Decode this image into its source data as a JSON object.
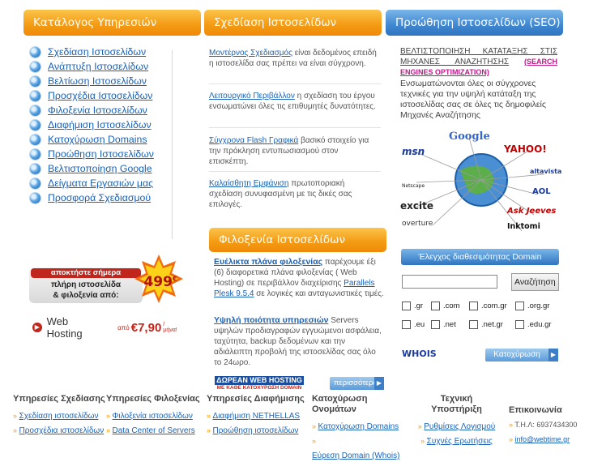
{
  "tabs": [
    {
      "label": "Κατάλογος Υπηρεσιών"
    },
    {
      "label": "Σχεδίαση Ιστοσελίδων"
    },
    {
      "label": "Προώθηση Ιστοσελίδων (SEO)"
    }
  ],
  "menu": [
    "Σχεδίαση Ιστοσελίδων",
    "Ανάπτυξη Ιστοσελίδων",
    "Βελτίωση Ιστοσελίδων",
    "Προσχέδια Ιστοσελίδων",
    "Φιλοξενία Ιστοσελίδων",
    "Διαφήμιση Ιστοσελίδων",
    "Κατοχύρωση Domains",
    "Προώθηση Ιστοσελίδων",
    "Βελτιστοποίηση Google",
    "Δείγματα Εργασιών μας",
    "Προσφορά Σχεδιασμού"
  ],
  "promo": {
    "line1": "αποκτήστε σήμερα",
    "line2": "πλήρη ιστοσελίδα",
    "line3": "& φιλοξενία από:",
    "price": "499",
    "currency": "€",
    "hosting_label": "Web Hosting",
    "hosting_from": "από",
    "hosting_price": "€7,90",
    "hosting_per": "/μήνα!"
  },
  "features": [
    {
      "link": "Μοντέρνος Σχεδιασμός",
      "text": " είναι δεδομένος επειδή η ιστοσελίδα σας πρέπει να είναι σύγχρονη."
    },
    {
      "link": "Λειτουργικό Περιβάλλον",
      "text": " η σχεδίαση του έργου ενσωματώνει όλες τις επιθυμητές δυνατότητες."
    },
    {
      "link": "Σύγχρονα Flash Γραφικά",
      "text": " βασικό στοιχείο για την πρόκληση εντυπωσιασμού στον επισκέπτη."
    },
    {
      "link": "Καλαίσθητη Εμφάνιση",
      "text": " πρωτοποριακή σχεδίαση συνυφασμένη με τις δικές σας επιλογές."
    }
  ],
  "hosting_section": {
    "title": "Φιλοξενία Ιστοσελίδων",
    "p1_link": "Ευέλικτα πλάνα φιλοξενίας",
    "p1_text_a": " παρέχουμε έξι (6) διαφορετικά πλάνα φιλοξενίας ( Web Hosting) σε περιβάλλον διαχείρισης ",
    "p1_link2": "Parallels Plesk 9.5.4",
    "p1_text_b": " σε λογικές και ανταγωνιστικές τιμές.",
    "p2_link": "Υψηλή ποιότητα υπηρεσιών",
    "p2_text": " Servers υψηλών προδιαγραφών εγγυώμενοι ασφάλεια, ταχύτητα, backup δεδομένων και την αδιάλειπτη προβολή της ιστοσελίδας σας όλο το 24ωρο.",
    "banner_line1": "ΔΩΡΕΑΝ WEB HOSTING",
    "banner_line2": "ΜΕ ΚΑΘΕ ΚΑΤΟΧΥΡΩΣΗ DOMAIN",
    "more_label": "περισσότερα"
  },
  "seo": {
    "heading": "ΒΕΛΤΙΣΤΟΠΟΙΗΣΗ ΚΑΤΑΤΑΞΗΣ ΣΤΙΣ ΜΗΧΑΝΕΣ ΑΝΑΖΗΤΗΣΗΣ",
    "heading_en": "(SEARCH ENGINES OPTIMIZATION)",
    "body": "Ενσωματώνονται όλες οι σύγχρονες τεχνικές για την υψηλή κατάταξη της ιστοσελίδας σας σε όλες τις δημοφιλείς Μηχανές Αναζήτησης",
    "engines": [
      "msn",
      "Google",
      "YAHOO!",
      "altavista",
      "Netscape",
      "AOL",
      "excite",
      "Ask Jeeves",
      "overture",
      "Inktomi"
    ]
  },
  "domain": {
    "title": "Έλεγχος διαθεσιμότητας Domain",
    "input_value": "",
    "search_label": "Αναζήτηση",
    "tlds_row1": [
      ".gr",
      ".com",
      ".com.gr",
      ".org.gr"
    ],
    "tlds_row2": [
      ".eu",
      ".net",
      ".net.gr",
      ".edu.gr"
    ],
    "whois": "WHOIS",
    "register_label": "Κατοχύρωση"
  },
  "footer": [
    {
      "heading": "Υπηρεσίες Σχεδίασης",
      "links": [
        "Σχεδίαση ιστοσελίδων",
        "Προσχέδια ιστοσελίδων"
      ]
    },
    {
      "heading": "Υπηρεσίες Φιλοξενίας",
      "links": [
        "Φιλοξενία ιστοσελίδων",
        "Data Center of Servers"
      ]
    },
    {
      "heading": "Υπηρεσίες Διαφήμισης",
      "links": [
        "Διαφήμιση NETHELLAS",
        "Προώθηση ιστοσελίδων"
      ]
    },
    {
      "heading": "Κατοχύρωση Ονομάτων",
      "links": [
        "Κατοχύρωση Domains",
        "Εύρεση Domain (Whois)"
      ]
    },
    {
      "heading": "Τεχνική Υποστήριξη",
      "links": [
        "Ρυθμίσεις Λογισμού",
        "Συχνές Ερωτήσεις"
      ]
    },
    {
      "heading": "Επικοινωνία",
      "links": [
        "Τ.Η.Λ: 6937434300",
        "info@webtime.gr"
      ]
    }
  ],
  "colors": {
    "orange": "#f49a12",
    "blue": "#3f87d0",
    "link": "#1a62b8"
  }
}
